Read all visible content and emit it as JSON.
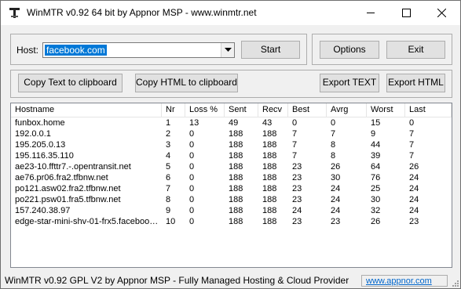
{
  "window": {
    "title": "WinMTR v0.92 64 bit by Appnor MSP - www.winmtr.net",
    "minimize_icon": "minimize-icon",
    "maximize_icon": "maximize-icon",
    "close_icon": "close-icon"
  },
  "host": {
    "label": "Host:",
    "value": "facebook.com"
  },
  "buttons": {
    "start": "Start",
    "options": "Options",
    "exit": "Exit",
    "copy_text": "Copy Text to clipboard",
    "copy_html": "Copy HTML to clipboard",
    "export_text": "Export TEXT",
    "export_html": "Export HTML"
  },
  "table": {
    "columns": [
      "Hostname",
      "Nr",
      "Loss %",
      "Sent",
      "Recv",
      "Best",
      "Avrg",
      "Worst",
      "Last"
    ],
    "rows": [
      [
        "funbox.home",
        "1",
        "13",
        "49",
        "43",
        "0",
        "0",
        "15",
        "0"
      ],
      [
        "192.0.0.1",
        "2",
        "0",
        "188",
        "188",
        "7",
        "7",
        "9",
        "7"
      ],
      [
        "195.205.0.13",
        "3",
        "0",
        "188",
        "188",
        "7",
        "8",
        "44",
        "7"
      ],
      [
        "195.116.35.110",
        "4",
        "0",
        "188",
        "188",
        "7",
        "8",
        "39",
        "7"
      ],
      [
        "ae23-10.ffttr7.-.opentransit.net",
        "5",
        "0",
        "188",
        "188",
        "23",
        "26",
        "64",
        "26"
      ],
      [
        "ae76.pr06.fra2.tfbnw.net",
        "6",
        "0",
        "188",
        "188",
        "23",
        "30",
        "76",
        "24"
      ],
      [
        "po121.asw02.fra2.tfbnw.net",
        "7",
        "0",
        "188",
        "188",
        "23",
        "24",
        "25",
        "24"
      ],
      [
        "po221.psw01.fra5.tfbnw.net",
        "8",
        "0",
        "188",
        "188",
        "23",
        "24",
        "30",
        "24"
      ],
      [
        "157.240.38.97",
        "9",
        "0",
        "188",
        "188",
        "24",
        "24",
        "32",
        "24"
      ],
      [
        "edge-star-mini-shv-01-frx5.facebook....",
        "10",
        "0",
        "188",
        "188",
        "23",
        "23",
        "26",
        "23"
      ]
    ]
  },
  "status": {
    "text": "WinMTR v0.92 GPL V2 by Appnor MSP - Fully Managed Hosting & Cloud Provider",
    "link": "www.appnor.com"
  }
}
